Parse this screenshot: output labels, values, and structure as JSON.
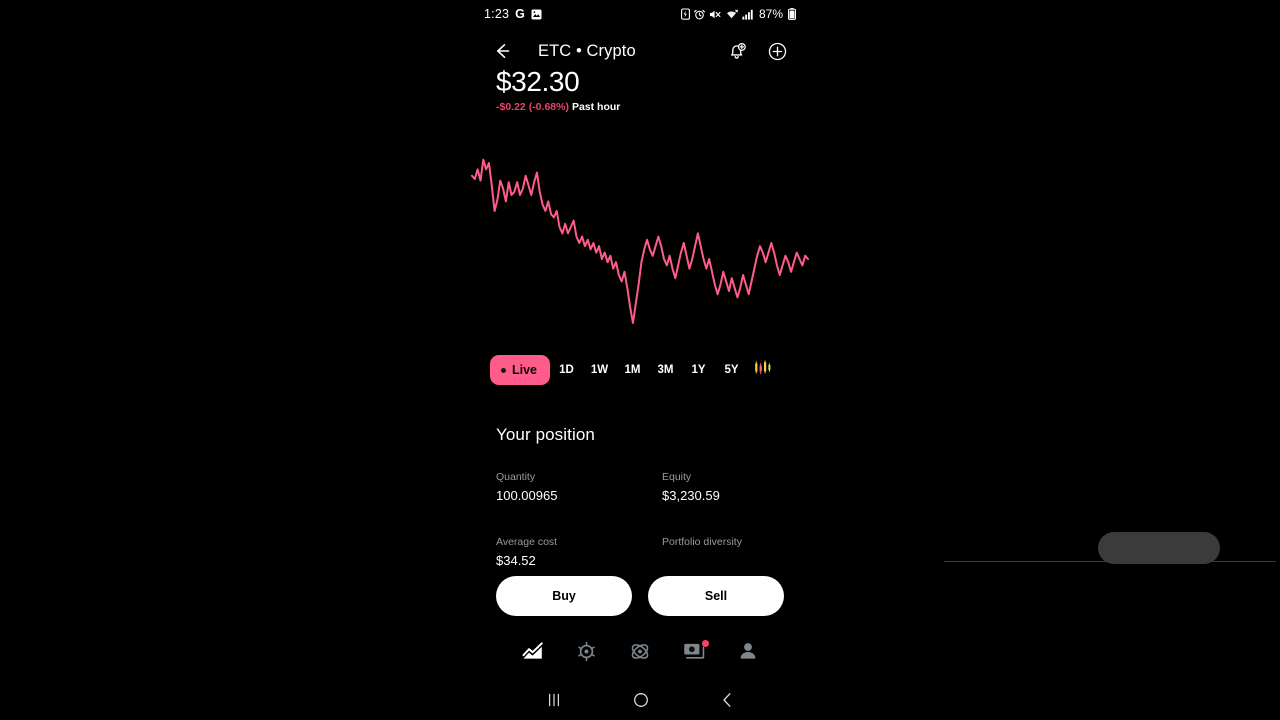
{
  "status_bar": {
    "time": "1:23",
    "google_label": "G",
    "battery_percent": "87%",
    "icons": [
      "gallery-icon",
      "battery-saver-icon",
      "alarm-icon",
      "mute-icon",
      "wifi-icon",
      "signal-icon",
      "battery-icon"
    ]
  },
  "header": {
    "back_label": "back-arrow-icon",
    "title": "ETC • Crypto",
    "alert_label": "add-alert-bell-icon",
    "add_label": "add-circle-icon"
  },
  "price": {
    "value": "$32.30",
    "change": "-$0.22 (-0.68%)",
    "period": "Past hour",
    "change_color": "#E8436B"
  },
  "chart_data": {
    "type": "line",
    "title": "",
    "xlabel": "",
    "ylabel": "",
    "line_color": "#FF5C8A",
    "grid": false,
    "legend": "none",
    "x": [
      0,
      1,
      2,
      3,
      4,
      5,
      6,
      7,
      8,
      9,
      10,
      11,
      12,
      13,
      14,
      15,
      16,
      17,
      18,
      19,
      20,
      21,
      22,
      23,
      24,
      25,
      26,
      27,
      28,
      29,
      30,
      31,
      32,
      33,
      34,
      35,
      36,
      37,
      38,
      39,
      40,
      41,
      42,
      43,
      44,
      45,
      46,
      47,
      48,
      49,
      50,
      51,
      52,
      53,
      54,
      55,
      56,
      57,
      58,
      59,
      60,
      61,
      62,
      63,
      64,
      65,
      66,
      67,
      68,
      69,
      70,
      71,
      72,
      73,
      74,
      75,
      76,
      77,
      78,
      79,
      80,
      81,
      82,
      83,
      84,
      85,
      86,
      87,
      88,
      89,
      90,
      91,
      92,
      93,
      94,
      95,
      96,
      97,
      98,
      99,
      100,
      101,
      102,
      103,
      104,
      105,
      106,
      107,
      108,
      109,
      110,
      111,
      112,
      113,
      114,
      115,
      116,
      117,
      118,
      119
    ],
    "values": [
      32.82,
      32.8,
      32.86,
      32.79,
      32.92,
      32.86,
      32.9,
      32.76,
      32.6,
      32.67,
      32.79,
      32.74,
      32.66,
      32.78,
      32.7,
      32.72,
      32.78,
      32.7,
      32.74,
      32.82,
      32.76,
      32.7,
      32.78,
      32.84,
      32.72,
      32.64,
      32.6,
      32.66,
      32.58,
      32.56,
      32.6,
      32.5,
      32.46,
      32.52,
      32.46,
      32.5,
      32.54,
      32.44,
      32.4,
      32.44,
      32.38,
      32.42,
      32.36,
      32.4,
      32.34,
      32.38,
      32.3,
      32.34,
      32.28,
      32.32,
      32.24,
      32.28,
      32.2,
      32.16,
      32.22,
      32.12,
      32.0,
      31.9,
      32.02,
      32.14,
      32.28,
      32.36,
      32.42,
      32.36,
      32.32,
      32.38,
      32.44,
      32.38,
      32.3,
      32.26,
      32.32,
      32.24,
      32.18,
      32.26,
      32.34,
      32.4,
      32.32,
      32.24,
      32.3,
      32.38,
      32.46,
      32.38,
      32.3,
      32.24,
      32.3,
      32.22,
      32.14,
      32.08,
      32.14,
      32.22,
      32.16,
      32.1,
      32.18,
      32.12,
      32.06,
      32.12,
      32.2,
      32.14,
      32.08,
      32.16,
      32.24,
      32.32,
      32.38,
      32.34,
      32.28,
      32.34,
      32.4,
      32.34,
      32.26,
      32.2,
      32.26,
      32.32,
      32.28,
      32.22,
      32.28,
      32.34,
      32.3,
      32.26,
      32.32,
      32.3
    ],
    "ylim": [
      31.85,
      32.95
    ]
  },
  "ranges": {
    "live": {
      "label": "Live",
      "active": true
    },
    "options": [
      {
        "label": "1D"
      },
      {
        "label": "1W"
      },
      {
        "label": "1M"
      },
      {
        "label": "3M"
      },
      {
        "label": "1Y"
      },
      {
        "label": "5Y"
      }
    ],
    "candlestick_icon": "candlestick-chart-icon",
    "active_color": "#FF5C8A"
  },
  "position": {
    "title": "Your position",
    "rows": [
      {
        "left": {
          "label": "Quantity",
          "value": "100.00965"
        },
        "right": {
          "label": "Equity",
          "value": "$3,230.59"
        }
      },
      {
        "left": {
          "label": "Average cost",
          "value": "$34.52"
        },
        "right": {
          "label": "Portfolio diversity",
          "value": ""
        }
      }
    ],
    "redacted": true
  },
  "actions": {
    "buy_label": "Buy",
    "sell_label": "Sell"
  },
  "bottom_nav": {
    "items": [
      {
        "name": "investing",
        "icon": "line-chart-icon",
        "active": true,
        "badge": false
      },
      {
        "name": "crypto",
        "icon": "crypto-coin-icon",
        "active": false,
        "badge": false
      },
      {
        "name": "discover",
        "icon": "atom-icon",
        "active": false,
        "badge": false
      },
      {
        "name": "cash-card",
        "icon": "card-icon",
        "active": false,
        "badge": true
      },
      {
        "name": "account",
        "icon": "person-icon",
        "active": false,
        "badge": false
      }
    ],
    "badge_color": "#FF3E6E"
  },
  "system_nav": {
    "recents_label": "recents-icon",
    "home_label": "home-icon",
    "back_label": "back-icon"
  }
}
